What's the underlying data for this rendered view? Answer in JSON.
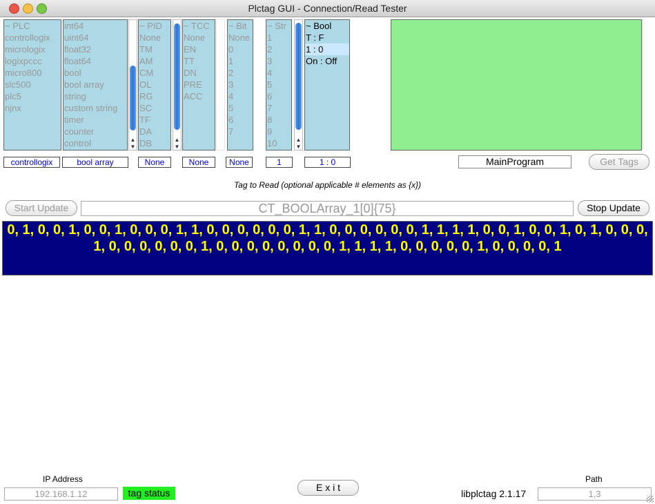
{
  "window": {
    "title": "Plctag GUI - Connection/Read Tester"
  },
  "lists": {
    "plc": [
      "~ PLC",
      "controllogix",
      "micrologix",
      "logixpccc",
      "micro800",
      "slc500",
      "plc5",
      "njnx"
    ],
    "type": [
      "int64",
      "uint64",
      "float32",
      "float64",
      "bool",
      "bool array",
      "string",
      "custom string",
      "timer",
      "counter",
      "control"
    ],
    "pid": [
      "~ PID",
      "None",
      "TM",
      "AM",
      "CM",
      "OL",
      "RG",
      "SC",
      "TF",
      "DA",
      "DB"
    ],
    "tcc": [
      "~ TCC",
      "None",
      "EN",
      "TT",
      "DN",
      "PRE",
      "ACC"
    ],
    "bit": [
      "~ Bit",
      "None",
      "0",
      "1",
      "2",
      "3",
      "4",
      "5",
      "6",
      "7"
    ],
    "str": [
      "~ Str",
      "1",
      "2",
      "3",
      "4",
      "5",
      "6",
      "7",
      "8",
      "9",
      "10"
    ],
    "bool": [
      "~ Bool",
      "T : F",
      "1 : 0",
      "On : Off"
    ]
  },
  "selected": {
    "plc": "controllogix",
    "type": "bool array",
    "pid": "None",
    "tcc": "None",
    "bit": "None",
    "str": "1",
    "bool": "1 : 0"
  },
  "program": "MainProgram",
  "buttons": {
    "get_tags": "Get Tags",
    "start_update": "Start Update",
    "stop_update": "Stop Update",
    "exit": "E x i t"
  },
  "hint": "Tag to Read (optional applicable # elements as {x})",
  "tag_input": "CT_BOOLArray_1[0]{75}",
  "result": "0, 1, 0, 0, 1, 0, 0, 1, 0, 0, 0, 1, 1, 0, 0, 0, 0, 0, 0, 1, 1, 0, 0, 0, 0, 0, 0, 1, 1, 1, 1, 0, 0, 1, 0, 0, 1, 0, 1, 0, 0, 0, 1, 0, 0, 0, 0, 0, 0, 1, 0, 0, 0, 0, 0, 0, 0, 0, 1, 1, 1, 1, 0, 0, 0, 0, 0, 1, 0, 0, 0, 0, 1",
  "footer": {
    "ip_label": "IP Address",
    "ip_value": "192.168.1.12",
    "tag_status": "tag status",
    "library": "libplctag 2.1.17",
    "path_label": "Path",
    "path_value": "1,3"
  },
  "colors": {
    "list_bg": "#add8e6",
    "green_panel": "#90ee90",
    "result_bg": "#000080",
    "result_text": "#ffff00",
    "status_green": "#22ee22"
  }
}
